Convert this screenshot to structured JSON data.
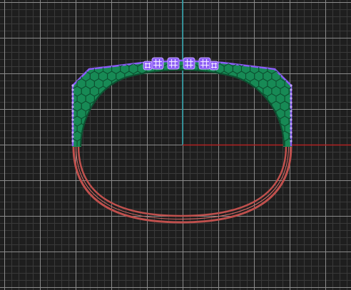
{
  "viewport": {
    "view": "top",
    "background_color": "#1e1e1e",
    "grid": {
      "visible": true,
      "minor_color": "#3a3a3a",
      "major_color": "#8a8a8a"
    },
    "axes": {
      "x_axis_color": "#b22222",
      "y_axis_color": "#2aa3ad"
    }
  },
  "model": {
    "name": "ring",
    "band": {
      "color": "#c0504d",
      "highlight_color": "#d86a66"
    },
    "setting": {
      "mesh_color": "#178a55",
      "wire_color": "#0d4f30",
      "selection_color": "#8b5cf6",
      "selection_glow": "#c4a5ff"
    },
    "prongs": {
      "count": 4,
      "color": "#8b5cf6",
      "cross_color": "#f0e6ff"
    }
  }
}
